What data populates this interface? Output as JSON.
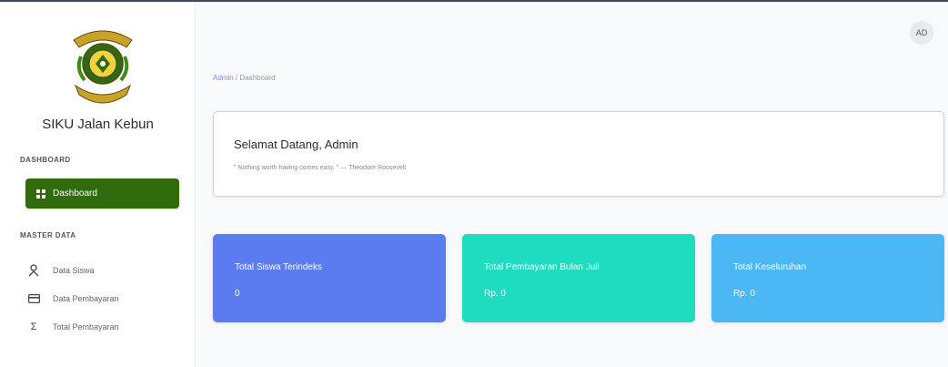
{
  "sidebar": {
    "brand": "SIKU Jalan Kebun",
    "sections": {
      "dashboard": "DASHBOARD",
      "master_data": "MASTER DATA"
    },
    "active_item": {
      "label": "Dashboard",
      "icon": "dashboard-icon"
    },
    "items": [
      {
        "label": "Data Siswa",
        "icon": "user-icon"
      },
      {
        "label": "Data Pembayaran",
        "icon": "card-icon"
      },
      {
        "label": "Total Pembayaran",
        "icon": "sigma-icon"
      }
    ]
  },
  "header": {
    "avatar_initials": "AD",
    "breadcrumb": {
      "parent": "Admin",
      "separator": "/",
      "current": "Dashboard"
    }
  },
  "welcome": {
    "title": "Selamat Datang, Admin",
    "quote": "\" Nothing worth having comes easy. \" — Theodore Roosevelt"
  },
  "stats": [
    {
      "label": "Total Siswa Terindeks",
      "value": "0",
      "color": "#5b7cf0"
    },
    {
      "label": "Total Pembayaran Bulan Juli",
      "value": "Rp. 0",
      "color": "#1ddcc0"
    },
    {
      "label": "Total Keseluruhan",
      "value": "Rp. 0",
      "color": "#4bb8f5"
    }
  ],
  "colors": {
    "accent": "#2f6b0d",
    "sidebar_bg": "#ffffff",
    "page_bg": "#f8f9fa"
  }
}
